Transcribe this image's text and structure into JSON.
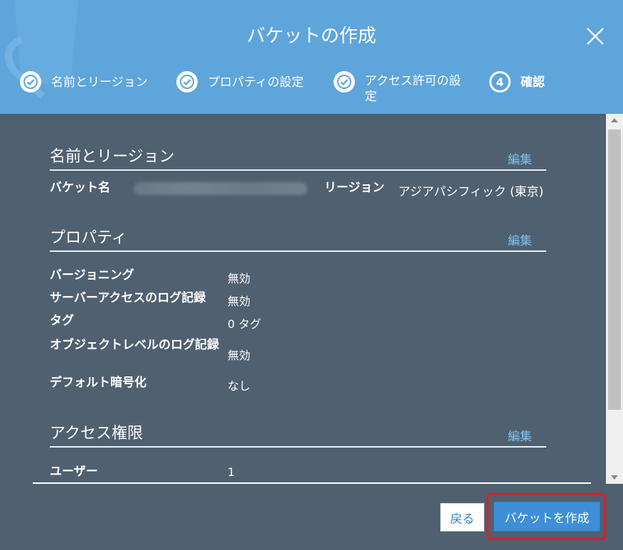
{
  "dialog": {
    "title": "バケットの作成"
  },
  "steps": [
    {
      "label": "名前とリージョン",
      "state": "done"
    },
    {
      "label": "プロパティの設定",
      "state": "done"
    },
    {
      "label": "アクセス許可の設定",
      "state": "done"
    },
    {
      "number": "4",
      "label": "確認",
      "state": "current"
    }
  ],
  "sections": {
    "name_region": {
      "title": "名前とリージョン",
      "edit": "編集",
      "bucket_name_label": "バケット名",
      "region_label": "リージョン",
      "region_value": "アジアパシフィック (東京)"
    },
    "properties": {
      "title": "プロパティ",
      "edit": "編集",
      "rows": [
        {
          "label": "バージョニング",
          "value": "無効"
        },
        {
          "label": "サーバーアクセスのログ記録",
          "value": "無効"
        },
        {
          "label": "タグ",
          "value": "0 タグ"
        },
        {
          "label": "オブジェクトレベルのログ記録",
          "value": "無効"
        },
        {
          "label": "デフォルト暗号化",
          "value": "なし"
        }
      ]
    },
    "access": {
      "title": "アクセス権限",
      "edit": "編集",
      "rows": [
        {
          "label": "ユーザー",
          "value": "1"
        }
      ]
    }
  },
  "footer": {
    "back": "戻る",
    "create": "バケットを作成"
  },
  "colors": {
    "header": "#5ea5dc",
    "body": "#4f6070",
    "link": "#7cc3f2",
    "primary_button": "#3d8fd7",
    "highlight": "#d2232a"
  }
}
